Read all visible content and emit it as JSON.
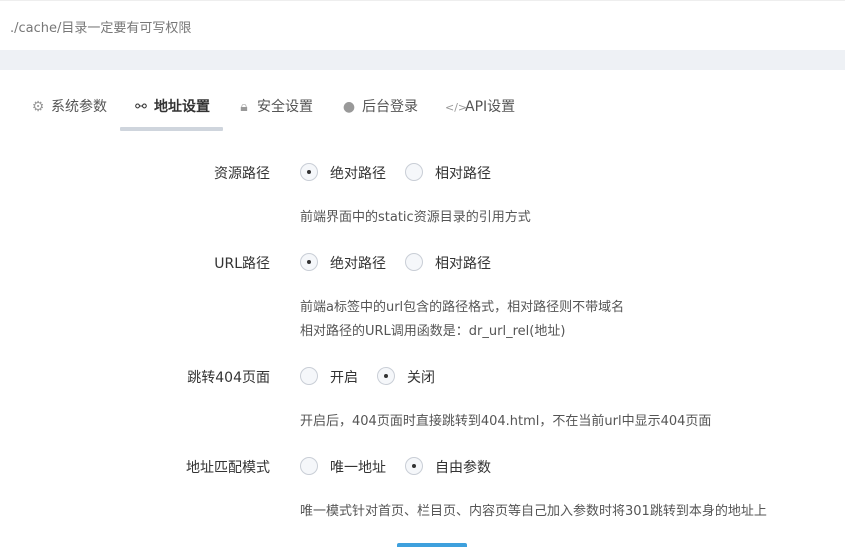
{
  "top_note": "./cache/目录一定要有可写权限",
  "tabs": [
    {
      "label": "系统参数",
      "icon": "gear-icon"
    },
    {
      "label": "地址设置",
      "icon": "link-icon"
    },
    {
      "label": "安全设置",
      "icon": "lock-icon"
    },
    {
      "label": "后台登录",
      "icon": "user-icon"
    },
    {
      "label": "API设置",
      "icon": "code-icon"
    }
  ],
  "active_tab": "地址设置",
  "fields": {
    "resource_path": {
      "label": "资源路径",
      "options": [
        "绝对路径",
        "相对路径"
      ],
      "selected": "绝对路径",
      "help": "前端界面中的static资源目录的引用方式"
    },
    "url_path": {
      "label": "URL路径",
      "options": [
        "绝对路径",
        "相对路径"
      ],
      "selected": "绝对路径",
      "help1": "前端a标签中的url包含的路径格式，相对路径则不带域名",
      "help2": "相对路径的URL调用函数是：dr_url_rel(地址)"
    },
    "jump_404": {
      "label": "跳转404页面",
      "options": [
        "开启",
        "关闭"
      ],
      "selected": "关闭",
      "help": "开启后，404页面时直接跳转到404.html，不在当前url中显示404页面"
    },
    "match_mode": {
      "label": "地址匹配模式",
      "options": [
        "唯一地址",
        "自由参数"
      ],
      "selected": "自由参数",
      "help": "唯一模式针对首页、栏目页、内容页等自己加入参数时将301跳转到本身的地址上"
    }
  },
  "colors": {
    "accent": "#3ea0dd",
    "tab_underline": "#cfd5dd",
    "band": "#eef1f5"
  }
}
